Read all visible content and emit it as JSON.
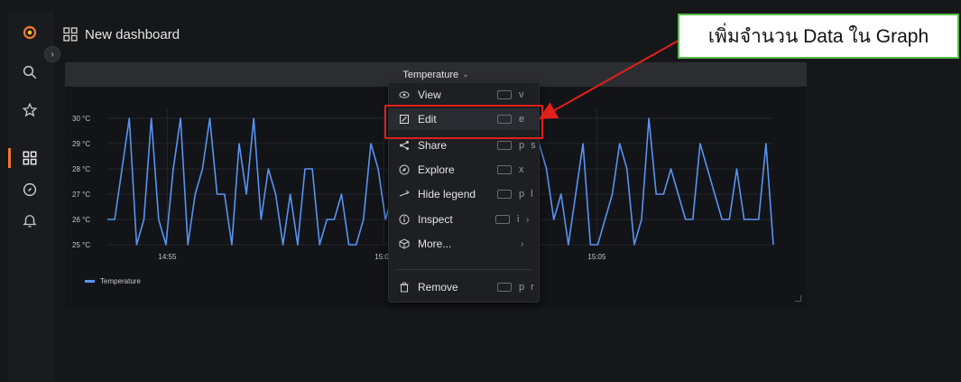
{
  "dashboard": {
    "title": "New dashboard"
  },
  "panel": {
    "title": "Temperature",
    "legend": "Temperature"
  },
  "chart_data": {
    "type": "line",
    "title": "Temperature",
    "xlabel": "",
    "ylabel": "",
    "x_ticks": [
      "14:55",
      "15:00",
      "15:05"
    ],
    "y_ticks": [
      "30 °C",
      "29 °C",
      "28 °C",
      "27 °C",
      "26 °C",
      "25 °C"
    ],
    "ylim": [
      25,
      30
    ],
    "series": [
      {
        "name": "Temperature",
        "color": "#5794f2",
        "values": [
          26,
          26,
          28,
          30,
          25,
          26,
          30,
          26,
          25,
          28,
          30,
          25,
          27,
          28,
          30,
          27,
          27,
          25,
          29,
          27,
          30,
          26,
          28,
          27,
          25,
          27,
          25,
          28,
          28,
          25,
          26,
          26,
          27,
          25,
          25,
          26,
          29,
          28,
          26,
          27,
          29,
          26,
          28,
          25,
          26,
          27,
          30,
          25,
          29,
          28,
          27,
          26,
          28,
          27,
          29,
          27,
          30,
          28,
          29,
          29,
          28,
          26,
          27,
          25,
          27,
          29,
          25,
          25,
          26,
          27,
          29,
          28,
          25,
          26,
          30,
          27,
          27,
          28,
          27,
          26,
          26,
          29,
          28,
          27,
          26,
          26,
          28,
          26,
          26,
          26,
          29,
          25
        ]
      }
    ],
    "grid": true,
    "legend": "bottom-left"
  },
  "menu": {
    "items": [
      {
        "label": "View",
        "shortcut": "v",
        "icon": "eye-icon"
      },
      {
        "label": "Edit",
        "shortcut": "e",
        "icon": "edit-icon"
      },
      {
        "label": "Share",
        "shortcut": "p s",
        "icon": "share-icon"
      },
      {
        "label": "Explore",
        "shortcut": "x",
        "icon": "compass-icon"
      },
      {
        "label": "Hide legend",
        "shortcut": "p l",
        "icon": "swap-icon"
      },
      {
        "label": "Inspect",
        "shortcut": "i",
        "icon": "info-icon"
      },
      {
        "label": "More...",
        "shortcut": "",
        "icon": "cube-icon"
      },
      {
        "label": "Remove",
        "shortcut": "p r",
        "icon": "trash-icon"
      }
    ]
  },
  "callout": {
    "text": "เพิ่มจำนวน Data ใน Graph"
  },
  "colors": {
    "accent": "#f2762e",
    "series": "#5794f2",
    "highlight": "#e0201b",
    "callout_border": "#58b947"
  }
}
